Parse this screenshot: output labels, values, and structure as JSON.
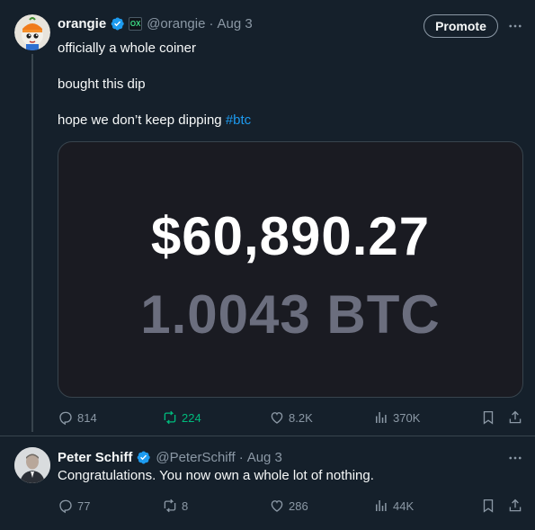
{
  "tweet": {
    "author": {
      "name": "orangie",
      "handle": "@orangie",
      "date": "Aug 3",
      "affiliate_badge_text": "OX"
    },
    "promote_label": "Promote",
    "lines": [
      "officially a whole coiner",
      "bought this dip",
      "hope we don’t keep dipping "
    ],
    "hashtag": "#btc",
    "media": {
      "usd_amount": "$60,890.27",
      "btc_amount": "1.0043 BTC"
    },
    "actions": {
      "replies": "814",
      "reposts": "224",
      "likes": "8.2K",
      "views": "370K"
    }
  },
  "reply": {
    "author": {
      "name": "Peter Schiff",
      "handle": "@PeterSchiff",
      "date": "Aug 3"
    },
    "text": "Congratulations. You now own a whole lot of nothing.",
    "actions": {
      "replies": "77",
      "reposts": "8",
      "likes": "286",
      "views": "44K"
    }
  },
  "colors": {
    "background": "#15202b",
    "accent": "#1d9bf0",
    "repost_active": "#00ba7c",
    "secondary_text": "#8b98a5"
  },
  "icons": {
    "reply": "speech-bubble",
    "repost": "loop-arrows",
    "like": "heart",
    "views": "bar-chart",
    "bookmark": "bookmark",
    "share": "upload-arrow",
    "more": "three-dots",
    "verified": "blue-check-badge"
  }
}
